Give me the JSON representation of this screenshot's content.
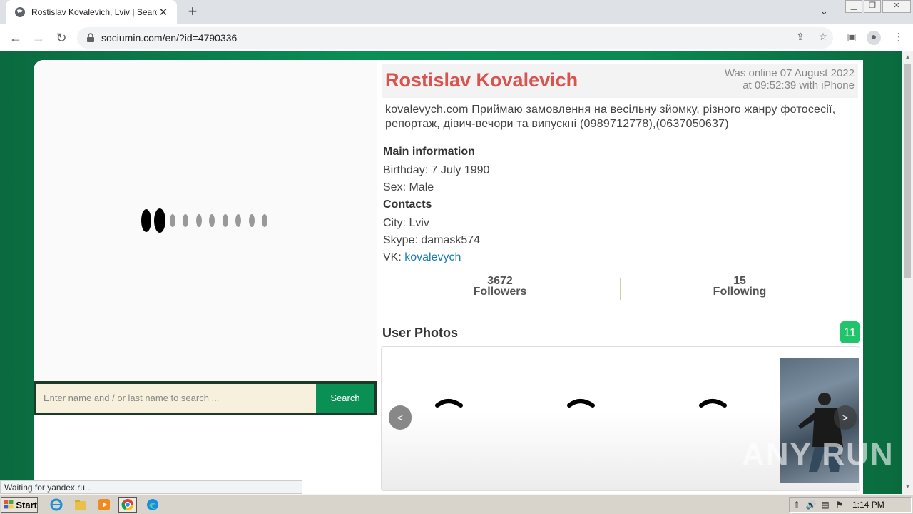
{
  "browser": {
    "tab_title": "Rostislav Kovalevich, Lviv | Search I",
    "url": "sociumin.com/en/?id=4790336",
    "status_text": "Waiting for yandex.ru..."
  },
  "search": {
    "placeholder": "Enter name and / or last name to search ...",
    "button_label": "Search"
  },
  "profile": {
    "name": "Rostislav Kovalevich",
    "online_line1": "Was online 07 August 2022",
    "online_line2": "at 09:52:39 with iPhone",
    "status": "kovalevych.com Приймаю замовлення на весільну зйомку, різного жанру фотосесії, репортаж, дівич-вечори та випускні (0989712778),(0637050637)",
    "main_info_title": "Main information",
    "birthday": "Birthday: 7 July 1990",
    "sex": "Sex: Male",
    "contacts_title": "Contacts",
    "city": "City: Lviv",
    "skype": "Skype: damask574",
    "vk_label": "VK: ",
    "vk_link": "kovalevych",
    "followers_count": "3672",
    "followers_label": "Followers",
    "following_count": "15",
    "following_label": "Following",
    "photos_title": "User Photos",
    "photos_count": "11"
  },
  "gallery": {
    "prev_label": "<",
    "next_label": ">"
  },
  "watermark": "ANY RUN",
  "taskbar": {
    "start_label": "Start",
    "clock": "1:14 PM"
  }
}
